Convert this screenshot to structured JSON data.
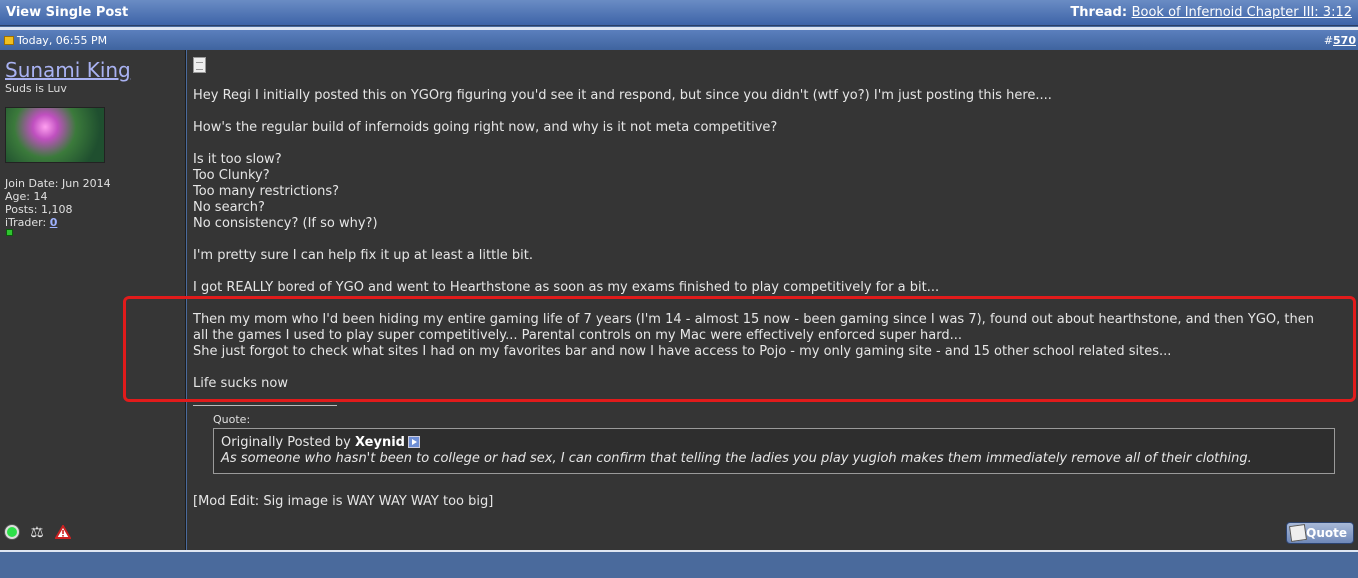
{
  "header": {
    "page_title": "View Single Post",
    "thread_label": "Thread:",
    "thread_link": "Book of Infernoid Chapter III: 3:12"
  },
  "postbar": {
    "date": "Today, 06:55 PM",
    "hash": "#",
    "post_number": "570"
  },
  "user": {
    "name": "Sunami King",
    "title": "Suds is Luv",
    "join_date": "Join Date: Jun 2014",
    "age": "Age: 14",
    "posts": "Posts: 1,108",
    "itrader_label": "iTrader:",
    "itrader_value": "0"
  },
  "message": {
    "lines": [
      "Hey Regi I initially posted this on YGOrg figuring you'd see it and respond, but since you didn't (wtf yo?) I'm just posting this here....",
      "",
      "How's the regular build of infernoids going right now, and why is it not meta competitive?",
      "",
      "Is it too slow?",
      "Too Clunky?",
      "Too many restrictions?",
      "No search?",
      "No consistency? (If so why?)",
      "",
      "I'm pretty sure I can help fix it up at least a little bit.",
      "",
      "I got REALLY bored of YGO and went to Hearthstone as soon as my exams finished to play competitively for a bit...",
      "",
      "Then my mom who I'd been hiding my entire gaming life of 7 years (I'm 14 - almost 15 now - been gaming since I was 7), found out about hearthstone, and then YGO, then",
      "all the games I used to play super competitively... Parental controls on my Mac were effectively enforced super hard...",
      "She just forgot to check what sites I had on my favorites bar and now I have access to Pojo - my only gaming site - and 15 other school related sites...",
      "",
      "Life sucks now"
    ]
  },
  "quote": {
    "label": "Quote:",
    "originally_posted_by": "Originally Posted by",
    "author": "Xeynid",
    "text": "As someone who hasn't been to college or had sex, I can confirm that telling the ladies you play yugioh makes them immediately remove all of their clothing."
  },
  "mod_edit": "[Mod Edit: Sig image is WAY WAY WAY too big]",
  "buttons": {
    "quote": "Quote"
  },
  "colors": {
    "highlight": "#e11b1b",
    "username": "#a9b2f2",
    "header_blue": "#4a6a9c"
  }
}
